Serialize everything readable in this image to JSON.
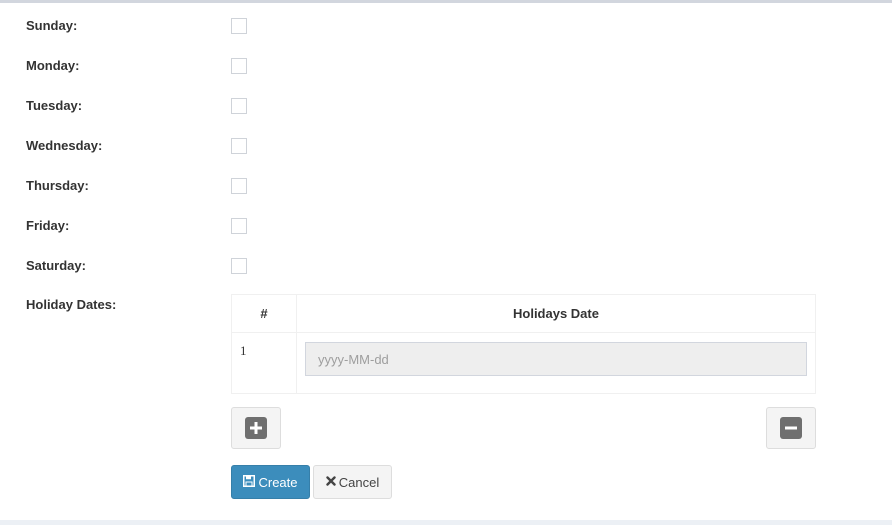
{
  "days": [
    {
      "label": "Sunday:",
      "checked": false
    },
    {
      "label": "Monday:",
      "checked": false
    },
    {
      "label": "Tuesday:",
      "checked": false
    },
    {
      "label": "Wednesday:",
      "checked": false
    },
    {
      "label": "Thursday:",
      "checked": false
    },
    {
      "label": "Friday:",
      "checked": false
    },
    {
      "label": "Saturday:",
      "checked": false
    }
  ],
  "holidays": {
    "label": "Holiday Dates:",
    "columns": [
      "#",
      "Holidays Date"
    ],
    "rows": [
      {
        "index": "1",
        "value": "",
        "placeholder": "yyyy-MM-dd"
      }
    ],
    "add_icon": "plus-square-icon",
    "remove_icon": "minus-square-icon"
  },
  "actions": {
    "create_label": "Create",
    "create_icon": "save-icon",
    "cancel_label": "Cancel",
    "cancel_icon": "times-icon"
  },
  "colors": {
    "primary": "#3c8dbc",
    "default_button": "#f4f4f4",
    "icon_gray": "#6f6f6f"
  }
}
